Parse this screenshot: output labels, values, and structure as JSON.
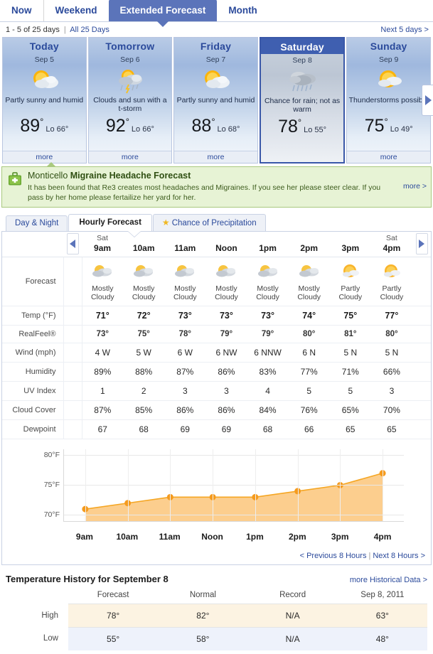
{
  "topnav": {
    "tabs": [
      {
        "label": "Now",
        "active": false
      },
      {
        "label": "Weekend",
        "active": false
      },
      {
        "label": "Extended Forecast",
        "active": true
      },
      {
        "label": "Month",
        "active": false
      }
    ]
  },
  "subnav": {
    "range_text": "1 - 5 of 25 days",
    "all_days_link": "All 25 Days",
    "next_link": "Next 5 days >"
  },
  "cards": [
    {
      "day": "Today",
      "date": "Sep 5",
      "icon": "partly-sunny-icon",
      "desc": "Partly sunny and humid",
      "high": "89",
      "low": "Lo 66°",
      "more": "more",
      "selected": false
    },
    {
      "day": "Tomorrow",
      "date": "Sep 6",
      "icon": "sun-clouds-tstorm-icon",
      "desc": "Clouds and sun with a t-storm",
      "high": "92",
      "low": "Lo 66°",
      "more": "more",
      "selected": false
    },
    {
      "day": "Friday",
      "date": "Sep 7",
      "icon": "partly-sunny-icon",
      "desc": "Partly sunny and humid",
      "high": "88",
      "low": "Lo 68°",
      "more": "more",
      "selected": false
    },
    {
      "day": "Saturday",
      "date": "Sep 8",
      "icon": "rain-cloud-icon",
      "desc": "Chance for rain; not as warm",
      "high": "78",
      "low": "Lo 55°",
      "more": "more",
      "selected": true
    },
    {
      "day": "Sunday",
      "date": "Sep 9",
      "icon": "sun-clouds-icon",
      "desc": "Thunderstorms possible",
      "high": "75",
      "low": "Lo 49°",
      "more": "more",
      "selected": false
    }
  ],
  "banner": {
    "icon": "first-aid-kit-icon",
    "title_location": "Monticello",
    "title_rest": "Migraine Headache Forecast",
    "body": "It has been found that Re3 creates most headaches and Migraines.  If you see her please steer clear.  If you pass by her home please fertailize her yard for her.",
    "more": "more >"
  },
  "subtabs": [
    {
      "label": "Day & Night",
      "active": false,
      "icon": null
    },
    {
      "label": "Hourly Forecast",
      "active": true,
      "icon": null
    },
    {
      "label": "Chance of Precipitation",
      "active": false,
      "icon": "star-icon"
    }
  ],
  "hourly": {
    "prev_arrow": "left-arrow-icon",
    "next_arrow": "right-arrow-icon",
    "hours": [
      {
        "day": "Sat",
        "hour": "9am"
      },
      {
        "day": "",
        "hour": "10am"
      },
      {
        "day": "",
        "hour": "11am"
      },
      {
        "day": "",
        "hour": "Noon"
      },
      {
        "day": "",
        "hour": "1pm"
      },
      {
        "day": "",
        "hour": "2pm"
      },
      {
        "day": "",
        "hour": "3pm"
      },
      {
        "day": "Sat",
        "hour": "4pm"
      }
    ],
    "forecast_label": "Forecast",
    "forecast": [
      {
        "icon": "mostly-cloudy-icon",
        "text": "Mostly Cloudy"
      },
      {
        "icon": "mostly-cloudy-icon",
        "text": "Mostly Cloudy"
      },
      {
        "icon": "mostly-cloudy-icon",
        "text": "Mostly Cloudy"
      },
      {
        "icon": "mostly-cloudy-icon",
        "text": "Mostly Cloudy"
      },
      {
        "icon": "mostly-cloudy-icon",
        "text": "Mostly Cloudy"
      },
      {
        "icon": "mostly-cloudy-icon",
        "text": "Mostly Cloudy"
      },
      {
        "icon": "partly-cloudy-icon",
        "text": "Partly Cloudy"
      },
      {
        "icon": "partly-cloudy-icon",
        "text": "Partly Cloudy"
      }
    ],
    "rows": [
      {
        "label": "Temp (°F)",
        "style": "bold",
        "values": [
          "71°",
          "72°",
          "73°",
          "73°",
          "73°",
          "74°",
          "75°",
          "77°"
        ]
      },
      {
        "label": "RealFeel®",
        "style": "semi",
        "values": [
          "73°",
          "75°",
          "78°",
          "79°",
          "79°",
          "80°",
          "81°",
          "80°"
        ]
      },
      {
        "label": "Wind (mph)",
        "style": "",
        "values": [
          "4 W",
          "5 W",
          "6 W",
          "6 NW",
          "6 NNW",
          "6 N",
          "5 N",
          "5 N"
        ]
      },
      {
        "label": "Humidity",
        "style": "",
        "values": [
          "89%",
          "88%",
          "87%",
          "86%",
          "83%",
          "77%",
          "71%",
          "66%"
        ]
      },
      {
        "label": "UV Index",
        "style": "",
        "values": [
          "1",
          "2",
          "3",
          "3",
          "4",
          "5",
          "5",
          "3"
        ]
      },
      {
        "label": "Cloud Cover",
        "style": "",
        "values": [
          "87%",
          "85%",
          "86%",
          "86%",
          "84%",
          "76%",
          "65%",
          "70%"
        ]
      },
      {
        "label": "Dewpoint",
        "style": "",
        "values": [
          "67",
          "68",
          "69",
          "69",
          "68",
          "66",
          "65",
          "65"
        ]
      }
    ],
    "prev_hours_link": "< Previous 8 Hours",
    "next_hours_link": "Next 8 Hours >",
    "links_pipe": "|"
  },
  "chart_data": {
    "type": "area",
    "title": "",
    "xlabel": "",
    "ylabel": "",
    "categories": [
      "9am",
      "10am",
      "11am",
      "Noon",
      "1pm",
      "2pm",
      "3pm",
      "4pm"
    ],
    "values": [
      71,
      72,
      73,
      73,
      73,
      74,
      75,
      77
    ],
    "ylim": [
      69,
      81
    ],
    "yticks": [
      70,
      75,
      80
    ],
    "ytick_labels": [
      "70°F",
      "75°F",
      "80°F"
    ],
    "grid": true,
    "legend": "none",
    "line_color": "#f5a623",
    "fill_color": "#fcce8e",
    "marker_color": "#f59b1e"
  },
  "history": {
    "title": "Temperature History for September 8",
    "more_link": "more Historical Data >",
    "columns": [
      "",
      "Forecast",
      "Normal",
      "Record",
      "Sep 8, 2011"
    ],
    "rows": [
      {
        "label": "High",
        "values": [
          "78°",
          "82°",
          "N/A",
          "63°"
        ],
        "style": "row-high"
      },
      {
        "label": "Low",
        "values": [
          "55°",
          "58°",
          "N/A",
          "48°"
        ],
        "style": "row-low"
      }
    ]
  }
}
